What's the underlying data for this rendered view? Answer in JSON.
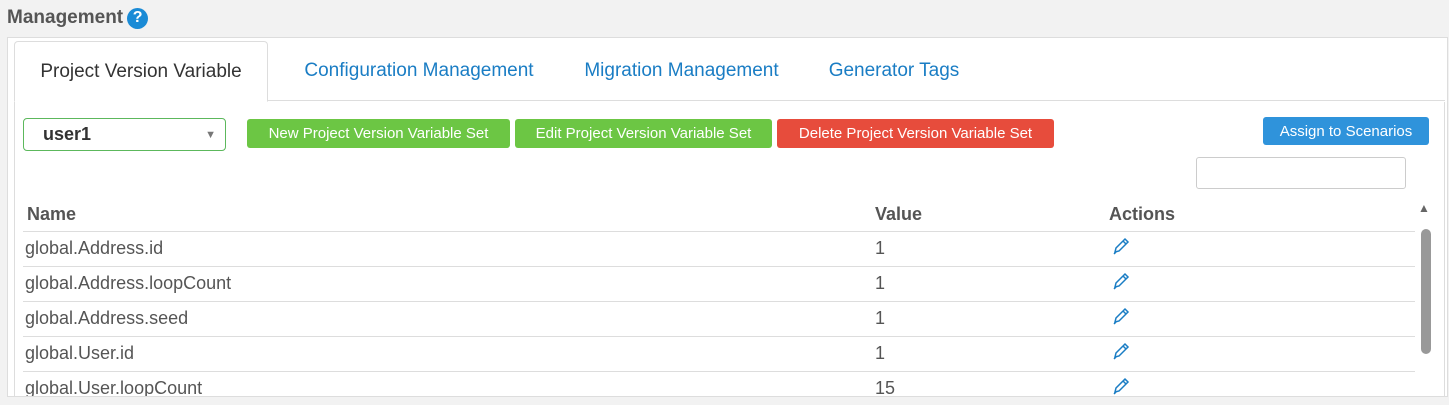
{
  "header": {
    "title": "Management",
    "help_icon": "?"
  },
  "tabs": [
    {
      "label": "Project Version Variable",
      "active": true
    },
    {
      "label": "Configuration Management",
      "active": false
    },
    {
      "label": "Migration Management",
      "active": false
    },
    {
      "label": "Generator Tags",
      "active": false
    }
  ],
  "toolbar": {
    "selected_set": "user1",
    "new_label": "New Project Version Variable Set",
    "edit_label": "Edit Project Version Variable Set",
    "delete_label": "Delete Project Version Variable Set",
    "assign_label": "Assign to Scenarios",
    "search_value": ""
  },
  "table": {
    "columns": [
      "Name",
      "Value",
      "Actions"
    ],
    "rows": [
      {
        "name": "global.Address.id",
        "value": "1",
        "action_icon": "pencil-icon"
      },
      {
        "name": "global.Address.loopCount",
        "value": "1",
        "action_icon": "pencil-icon"
      },
      {
        "name": "global.Address.seed",
        "value": "1",
        "action_icon": "pencil-icon"
      },
      {
        "name": "global.User.id",
        "value": "1",
        "action_icon": "pencil-icon"
      },
      {
        "name": "global.User.loopCount",
        "value": "15",
        "action_icon": "pencil-icon"
      }
    ]
  },
  "colors": {
    "accent": "#1a7dc4",
    "green_button": "#6cc644",
    "red_button": "#e74c3c",
    "blue_button": "#2f93db"
  }
}
